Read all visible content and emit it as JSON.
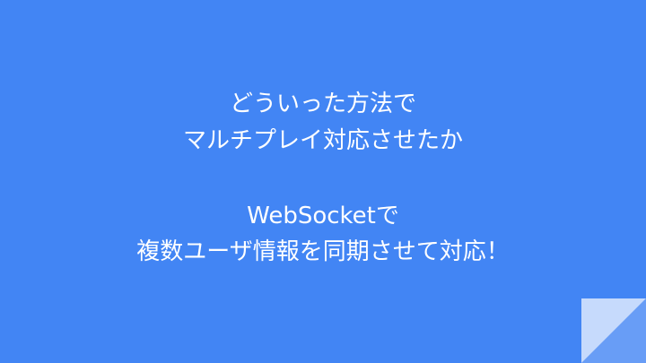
{
  "slide": {
    "lines": [
      "どういった方法で",
      "マルチプレイ対応させたか",
      "WebSocketで",
      "複数ユーザ情報を同期させて対応！"
    ]
  },
  "colors": {
    "background": "#4285f4",
    "text": "#ffffff",
    "corner_fold": "#c6dafc",
    "corner_shadow": "#aecbfa"
  }
}
